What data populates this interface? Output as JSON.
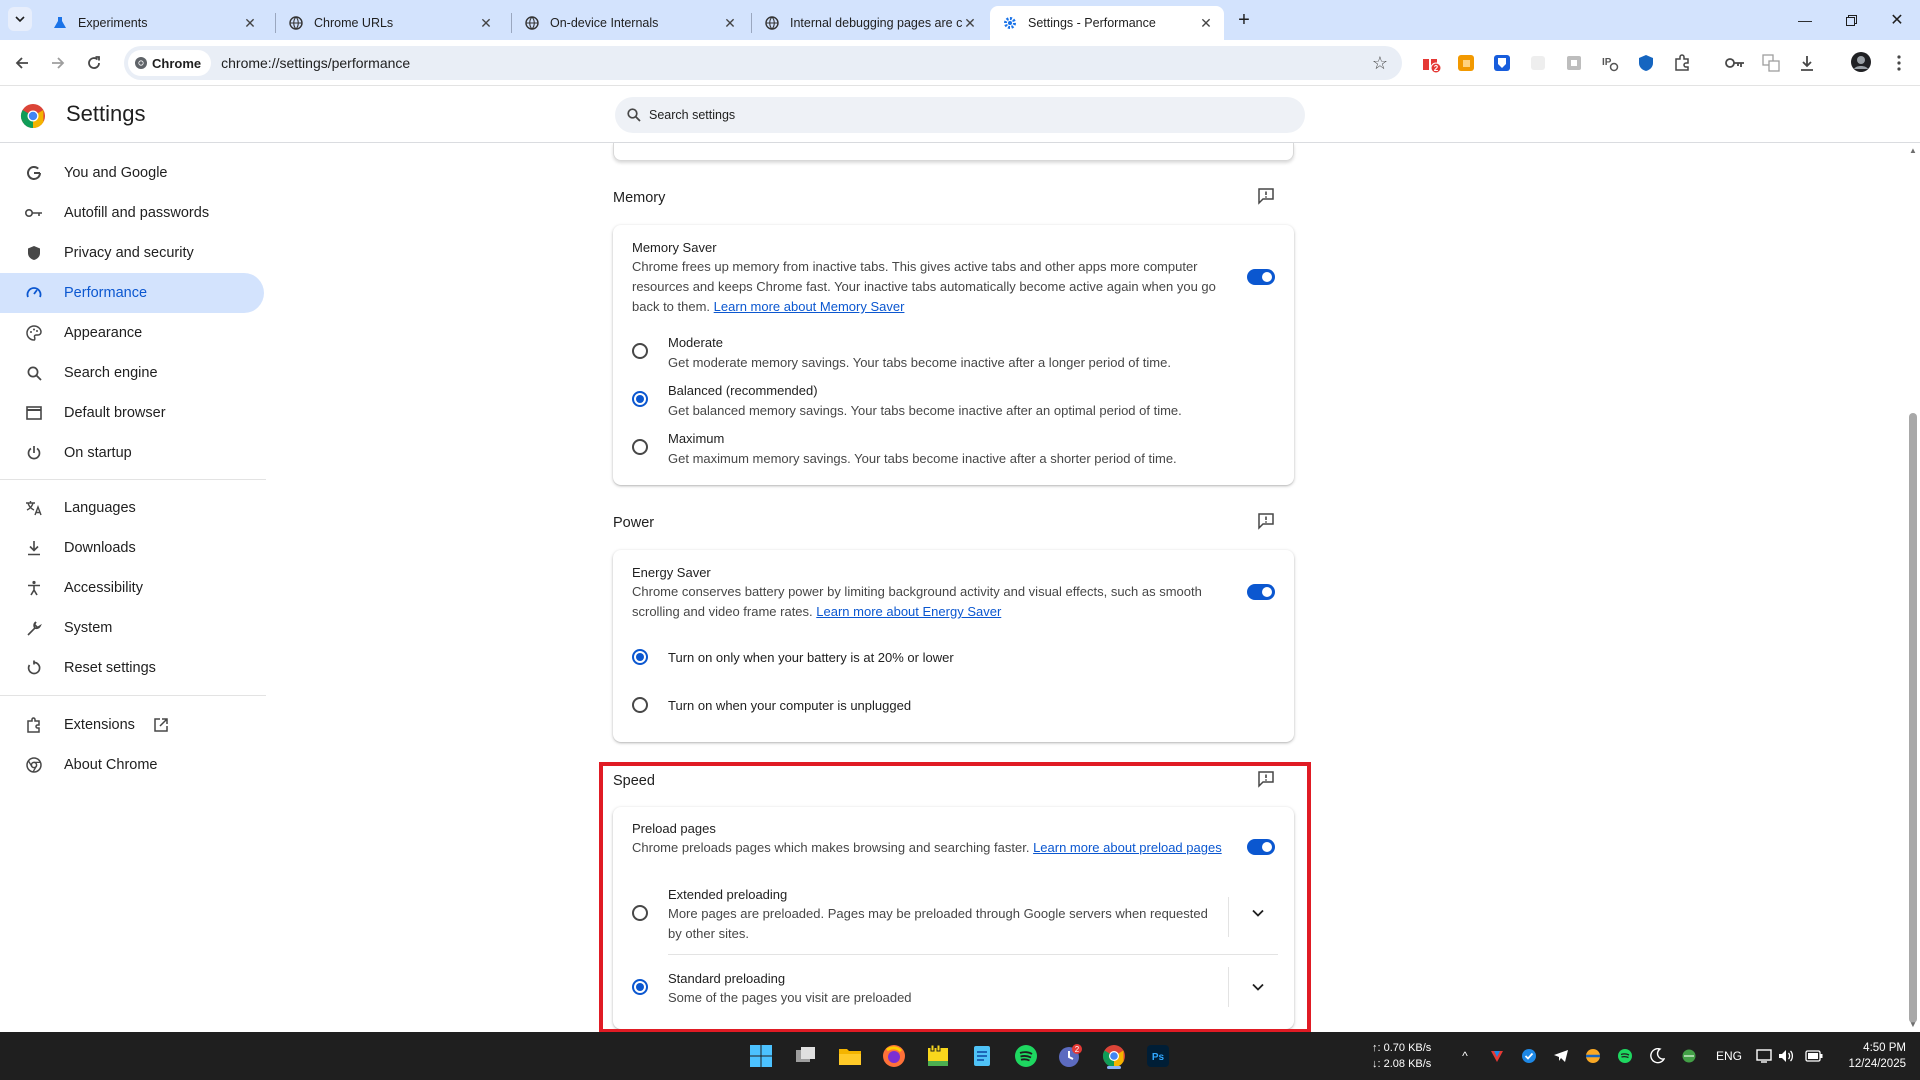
{
  "tabs": [
    {
      "label": "Experiments",
      "icon": "flask-icon"
    },
    {
      "label": "Chrome URLs",
      "icon": "globe-icon"
    },
    {
      "label": "On-device Internals",
      "icon": "globe-icon"
    },
    {
      "label": "Internal debugging pages are c",
      "icon": "globe-icon"
    },
    {
      "label": "Settings - Performance",
      "icon": "gear-icon",
      "active": true
    }
  ],
  "toolbar": {
    "chip_label": "Chrome",
    "url": "chrome://settings/performance",
    "ext_badge": "2"
  },
  "header": {
    "title": "Settings",
    "search_placeholder": "Search settings"
  },
  "sidebar": {
    "items": [
      {
        "label": "You and Google",
        "icon": "google-g-icon"
      },
      {
        "label": "Autofill and passwords",
        "icon": "key-icon"
      },
      {
        "label": "Privacy and security",
        "icon": "shield-icon"
      },
      {
        "label": "Performance",
        "icon": "speedometer-icon",
        "active": true
      },
      {
        "label": "Appearance",
        "icon": "palette-icon"
      },
      {
        "label": "Search engine",
        "icon": "search-icon"
      },
      {
        "label": "Default browser",
        "icon": "browser-window-icon"
      },
      {
        "label": "On startup",
        "icon": "power-icon"
      },
      {
        "label": "Languages",
        "icon": "translate-icon"
      },
      {
        "label": "Downloads",
        "icon": "download-icon"
      },
      {
        "label": "Accessibility",
        "icon": "accessibility-icon"
      },
      {
        "label": "System",
        "icon": "wrench-icon"
      },
      {
        "label": "Reset settings",
        "icon": "reset-icon"
      },
      {
        "label": "Extensions",
        "icon": "puzzle-icon"
      },
      {
        "label": "About Chrome",
        "icon": "chrome-icon"
      }
    ]
  },
  "memory": {
    "section_title": "Memory",
    "saver_title": "Memory Saver",
    "saver_desc_1": "Chrome frees up memory from inactive tabs. This gives active tabs and other apps more computer",
    "saver_desc_2": "resources and keeps Chrome fast. Your inactive tabs automatically become active again when you go",
    "saver_desc_3": "back to them.",
    "saver_link": "Learn more about Memory Saver",
    "saver_enabled": true,
    "options": [
      {
        "title": "Moderate",
        "desc": "Get moderate memory savings. Your tabs become inactive after a longer period of time.",
        "selected": false
      },
      {
        "title": "Balanced (recommended)",
        "desc": "Get balanced memory savings. Your tabs become inactive after an optimal period of time.",
        "selected": true
      },
      {
        "title": "Maximum",
        "desc": "Get maximum memory savings. Your tabs become inactive after a shorter period of time.",
        "selected": false
      }
    ]
  },
  "power": {
    "section_title": "Power",
    "saver_title": "Energy Saver",
    "saver_desc_1": "Chrome conserves battery power by limiting background activity and visual effects, such as smooth",
    "saver_desc_2": "scrolling and video frame rates.",
    "saver_link": "Learn more about Energy Saver",
    "saver_enabled": true,
    "options": [
      {
        "title": "Turn on only when your battery is at 20% or lower",
        "selected": true
      },
      {
        "title": "Turn on when your computer is unplugged",
        "selected": false
      }
    ]
  },
  "speed": {
    "section_title": "Speed",
    "preload_title": "Preload pages",
    "preload_desc": "Chrome preloads pages which makes browsing and searching faster.",
    "preload_link": "Learn more about preload pages",
    "preload_enabled": true,
    "options": [
      {
        "title": "Extended preloading",
        "desc_1": "More pages are preloaded. Pages may be preloaded through Google servers when requested",
        "desc_2": "by other sites.",
        "selected": false
      },
      {
        "title": "Standard preloading",
        "desc_1": "Some of the pages you visit are preloaded",
        "selected": true
      }
    ]
  },
  "taskbar": {
    "net_up": "↑: 0.70 KB/s",
    "net_down": "↓: 2.08 KB/s",
    "lang": "ENG",
    "time": "4:50 PM",
    "date": "12/24/2025",
    "badge": "2"
  },
  "colors": {
    "accent": "#0b57d0",
    "highlight": "#e01b24",
    "tabstrip": "#d3e3fd"
  }
}
